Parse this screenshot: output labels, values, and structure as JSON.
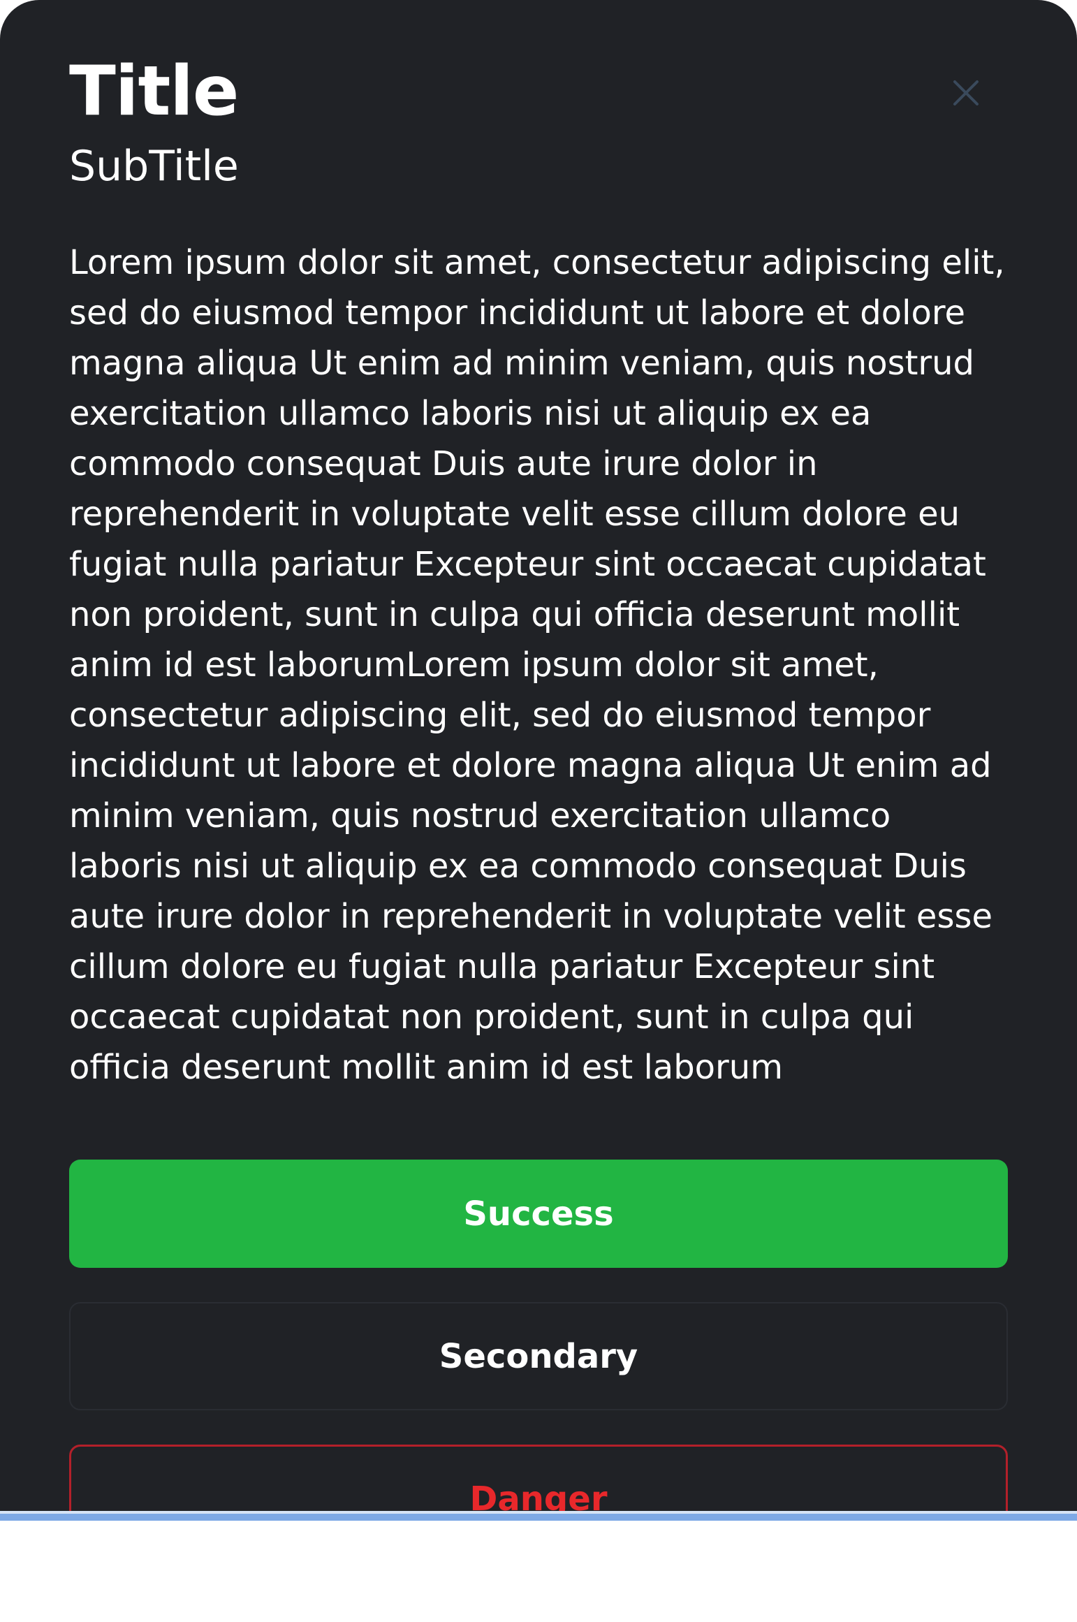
{
  "dialog": {
    "title": "Title",
    "subtitle": "SubTitle",
    "close_icon": "close-icon",
    "body": "Lorem ipsum dolor sit amet, consectetur adipiscing elit, sed do eiusmod tempor incididunt ut labore et dolore magna aliqua Ut enim ad minim veniam, quis nostrud exercitation ullamco laboris nisi ut aliquip ex ea commodo consequat Duis aute irure dolor in reprehenderit in voluptate velit esse cillum dolore eu fugiat nulla pariatur Excepteur sint occaecat cupidatat non proident, sunt in culpa qui officia deserunt mollit anim id est laborumLorem ipsum dolor sit amet, consectetur adipiscing elit, sed do eiusmod tempor incididunt ut labore et dolore magna aliqua Ut enim ad minim veniam, quis nostrud exercitation ullamco laboris nisi ut aliquip ex ea commodo consequat Duis aute irure dolor in reprehenderit in voluptate velit esse cillum dolore eu fugiat nulla pariatur Excepteur sint occaecat cupidatat non proident, sunt in culpa qui officia deserunt mollit anim id est laborum",
    "buttons": {
      "success_label": "Success",
      "secondary_label": "Secondary",
      "danger_label": "Danger"
    }
  },
  "colors": {
    "background": "#202226",
    "text": "#ffffff",
    "success": "#22b543",
    "danger": "#e8282b",
    "danger_border": "#b3202a",
    "close_icon": "#3a4a5c"
  }
}
